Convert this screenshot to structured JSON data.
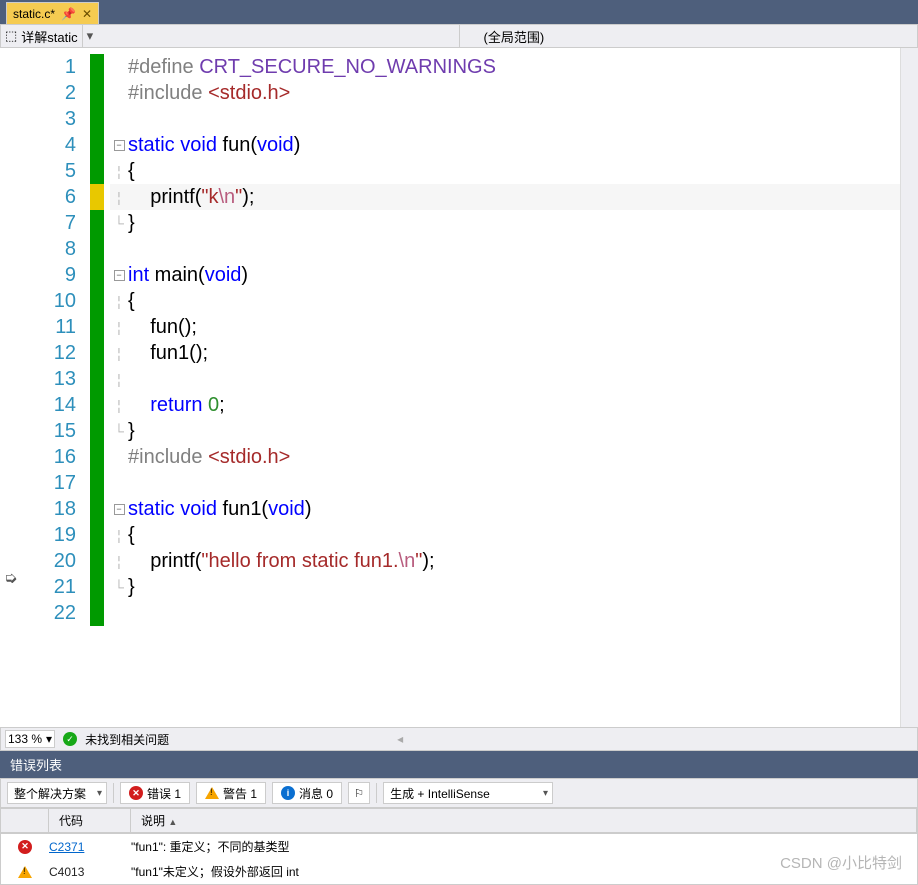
{
  "tab": {
    "label": "static.c*",
    "pin_icon": "📌",
    "close_icon": "✕"
  },
  "scope": {
    "left_icon": "⬚",
    "left": "详解static",
    "right": "(全局范围)"
  },
  "editor": {
    "lines": [
      {
        "n": 1,
        "mark": "green",
        "fold": "",
        "html": "<span class='c-directive'>#define</span> <span class='c-macro'>CRT_SECURE_NO_WARNINGS</span>"
      },
      {
        "n": 2,
        "mark": "green",
        "fold": "",
        "html": "<span class='c-directive'>#include</span> <span class='c-include'>&lt;stdio.h&gt;</span>"
      },
      {
        "n": 3,
        "mark": "green",
        "fold": "",
        "html": ""
      },
      {
        "n": 4,
        "mark": "green",
        "fold": "box",
        "html": "<span class='c-keyword'>static</span> <span class='c-keyword'>void</span> fun(<span class='c-keyword'>void</span>)"
      },
      {
        "n": 5,
        "mark": "green",
        "fold": "line",
        "html": "{"
      },
      {
        "n": 6,
        "mark": "yellow",
        "fold": "line",
        "hl": true,
        "html": "    printf(<span class='c-string'>\"k</span><span class='c-esc'>\\n</span><span class='c-string'>\"</span>);"
      },
      {
        "n": 7,
        "mark": "green",
        "fold": "end",
        "html": "}"
      },
      {
        "n": 8,
        "mark": "green",
        "fold": "",
        "html": ""
      },
      {
        "n": 9,
        "mark": "green",
        "fold": "box",
        "html": "<span class='c-keyword'>int</span> main(<span class='c-keyword'>void</span>)"
      },
      {
        "n": 10,
        "mark": "green",
        "fold": "line",
        "html": "{"
      },
      {
        "n": 11,
        "mark": "green",
        "fold": "line",
        "html": "    fun();"
      },
      {
        "n": 12,
        "mark": "green",
        "fold": "line",
        "html": "    fun1();"
      },
      {
        "n": 13,
        "mark": "green",
        "fold": "line",
        "html": ""
      },
      {
        "n": 14,
        "mark": "green",
        "fold": "line",
        "html": "    <span class='c-keyword'>return</span> <span class='c-num'>0</span>;"
      },
      {
        "n": 15,
        "mark": "green",
        "fold": "end",
        "html": "}"
      },
      {
        "n": 16,
        "mark": "green",
        "fold": "",
        "html": "<span class='c-directive'>#include</span> <span class='c-include'>&lt;stdio.h&gt;</span>"
      },
      {
        "n": 17,
        "mark": "green",
        "fold": "",
        "html": ""
      },
      {
        "n": 18,
        "mark": "green",
        "fold": "box",
        "html": "<span class='c-keyword'>static</span> <span class='c-keyword'>void</span> fun1(<span class='c-keyword'>void</span>)"
      },
      {
        "n": 19,
        "mark": "green",
        "fold": "line",
        "html": "{"
      },
      {
        "n": 20,
        "mark": "green",
        "fold": "line",
        "html": "    printf(<span class='c-string'>\"hello from static fun1.</span><span class='c-esc'>\\n</span><span class='c-string'>\"</span>);"
      },
      {
        "n": 21,
        "mark": "green",
        "fold": "end",
        "html": "}"
      },
      {
        "n": 22,
        "mark": "green",
        "fold": "",
        "html": ""
      }
    ]
  },
  "status": {
    "zoom": "133 %",
    "no_issues": "未找到相关问题"
  },
  "errorlist": {
    "title": "错误列表",
    "scope": "整个解决方案",
    "errors_label": "错误 1",
    "warnings_label": "警告 1",
    "messages_label": "消息 0",
    "source": "生成 + IntelliSense",
    "cols": {
      "code": "代码",
      "desc": "说明"
    },
    "rows": [
      {
        "type": "error",
        "code": "C2371",
        "link": true,
        "desc": "\"fun1\": 重定义；不同的基类型"
      },
      {
        "type": "warn",
        "code": "C4013",
        "link": false,
        "desc": "\"fun1\"未定义；假设外部返回 int"
      }
    ]
  },
  "watermark": "CSDN @小比特剑"
}
